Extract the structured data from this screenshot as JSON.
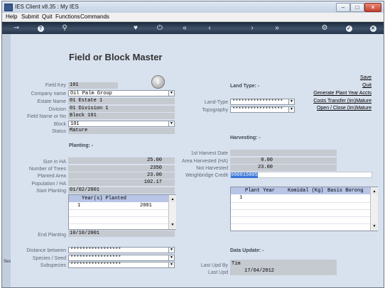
{
  "window": {
    "title": "IES Client v8.35 : My IES"
  },
  "menu": [
    "Help",
    "Submit",
    "Quit",
    "Functions",
    "Commands"
  ],
  "page_title": "Field or Block Master",
  "fields": {
    "field_key": {
      "label": "Field Key",
      "value": "101"
    },
    "company_name": {
      "label": "Company name",
      "value": "Oil Palm Group"
    },
    "estate_name": {
      "label": "Estate Name",
      "value": "01 Estate 1"
    },
    "division": {
      "label": "Division",
      "value": "01 Division 1"
    },
    "field_name": {
      "label": "Field Name or No",
      "value": "Block 101"
    },
    "block": {
      "label": "Block",
      "value": "101"
    },
    "status": {
      "label": "Status",
      "value": "Mature"
    }
  },
  "planting": {
    "heading": "Planting: -",
    "size_ha": {
      "label": "Size in HA",
      "value": "25.00"
    },
    "num_trees": {
      "label": "Number of Trees",
      "value": "2350"
    },
    "planted_area": {
      "label": "Planted Area",
      "value": "23.00"
    },
    "population_ha": {
      "label": "Population / HA",
      "value": "102.17"
    },
    "start_planting": {
      "label": "Start Planting",
      "value": "01/02/2001"
    },
    "grid": {
      "header": "Year(s) Planted",
      "rows": [
        {
          "num": "1",
          "value": "2001"
        }
      ]
    },
    "end_planting": {
      "label": "End Planting",
      "value": "10/10/2001"
    },
    "distance_between": {
      "label": "Distance between",
      "value": "*****************"
    },
    "species_seed": {
      "label": "Species / Seed",
      "value": "*****************"
    },
    "subspecies": {
      "label": "Subspecies",
      "value": "*****************"
    }
  },
  "land_type": {
    "heading": "Land Type: -",
    "land_type": {
      "label": "Land-Type",
      "value": "*****************"
    },
    "topography": {
      "label": "Topography",
      "value": "*****************"
    }
  },
  "links": [
    "Save",
    "Quit",
    "Generate Plant Year Accts",
    "Costs Transfer (Im)Mature",
    "Open / Close (Im)Mature"
  ],
  "harvesting": {
    "heading": "Harvesting: -",
    "first_harvest_date": {
      "label": "1st Harvest Date",
      "value": ""
    },
    "area_harvested": {
      "label": "Area Harvested (HA)",
      "value": "0.00"
    },
    "not_harvested": {
      "label": "Not Harvested",
      "value": "23.00"
    },
    "weighbridge_credit": {
      "label": "Weighbridge Credit",
      "value": "990016005"
    },
    "grid": {
      "headers": [
        "Plant Year",
        "Komidal (Kg)",
        "Basis Borong"
      ],
      "rows": [
        {
          "num": "1"
        }
      ]
    }
  },
  "data_update": {
    "heading": "Data Update: -",
    "last_upd_by": {
      "label": "Last Upd By",
      "value": "Tim"
    },
    "last_upd": {
      "label": "Last Upd",
      "value": "17/04/2012"
    }
  },
  "side_text": "Ses",
  "toolbar_icons": [
    "key-icon",
    "help-icon",
    "search-icon",
    "heart-icon",
    "power-icon",
    "rewind-icon",
    "back-icon",
    "forward-icon",
    "fast-forward-icon",
    "settings-icon",
    "confirm-icon",
    "close-icon"
  ]
}
